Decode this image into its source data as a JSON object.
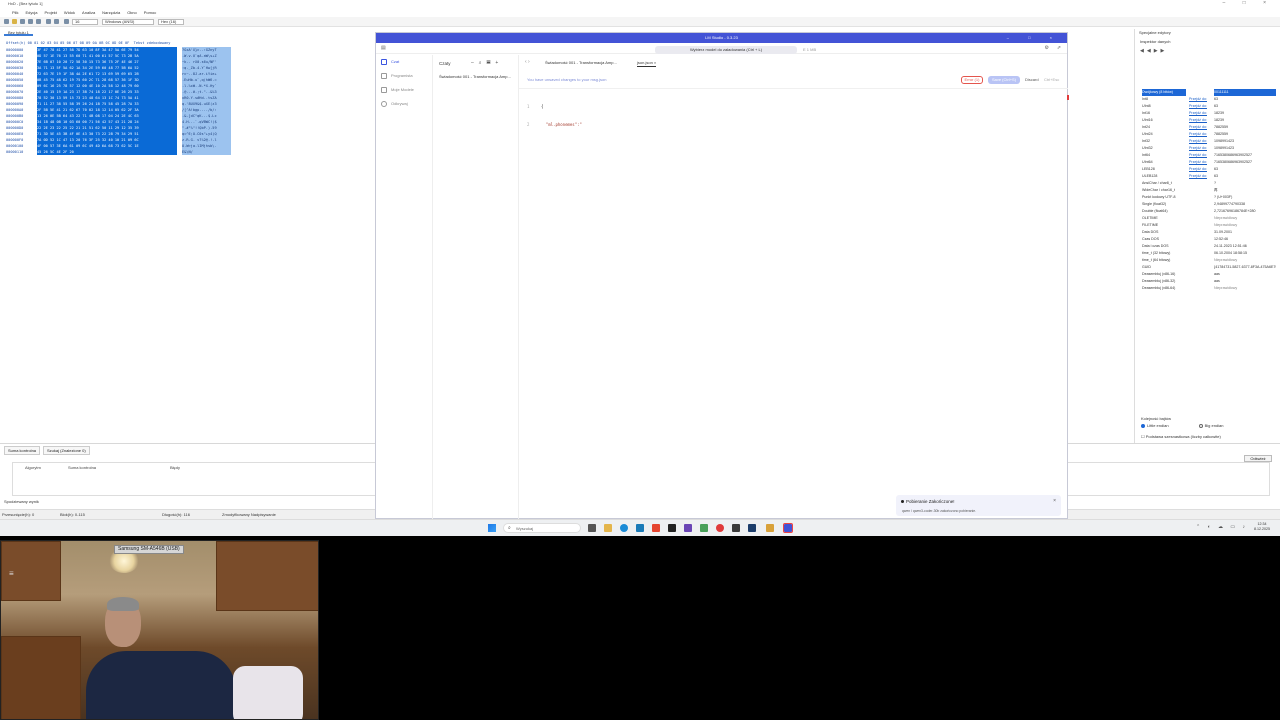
{
  "hxd": {
    "title": "HxD - [Bez tytułu 1]",
    "menu": [
      "Plik",
      "Edycja",
      "Projekt",
      "Widok",
      "Analiza",
      "Narzędzia",
      "Okno",
      "Pomoc"
    ],
    "bytes_per_row": "16",
    "encoding": "Windows (ANSI)",
    "number_base": "Hex (16)",
    "file_tab": "Bez tytułu 1",
    "hex_header": "Offset(h) 00 01 02 03 04 05 06 07 08 09 0A 0B 0C 0D 0E 0F  Tekst zdekodowany",
    "offsets": [
      "00000000",
      "00000010",
      "00000020",
      "00000030",
      "00000040",
      "00000050",
      "00000060",
      "00000070",
      "00000080",
      "00000090",
      "000000A0",
      "000000B0",
      "000000C0",
      "000000D0",
      "000000E0",
      "000000F0",
      "00000100",
      "00000110"
    ],
    "hex_rows": [
      "3F 47 78 41 27 58 7D 63 10 8F 3A 47 5A 6E 79 54",
      "0D 57 1E 76 13 55 60 71 41 00 61 57 5C 73 2B 5A",
      "7E 6B 07 10 20 72 58 30 15 73 36 75 2F 4E 46 27",
      "3A 71 13 5F 5A 62 1A 34 2E 59 60 48 77 5B 6A 52",
      "72 63 7E 19 1F 38 4A 2E 61 72 13 69 59 69 65 2B",
      "0B 45 75 48 62 19 75 60 2C 71 28 68 57 36 1F 3D",
      "09 6C 16 25 78 57 12 00 4E 10 2A 58 12 48 79 60",
      "2E 40 15 19 1A 23 17 3B 74 18 22 17 0E 26 25 33",
      "78 52 30 13 59 15 73 23 48 64 13 1C 74 73 5A 41",
      "71 11 27 38 55 58 39 26 24 1B 75 58 45 28 7A 33",
      "2F 5B 5E 41 21 62 67 70 02 18 12 14 05 62 2F 3A",
      "13 26 0E 5B 64 43 22 71 4B 08 17 04 24 2E 4C 63",
      "34 1B 48 0B 10 03 60 00 71 56 42 57 43 21 28 24",
      "22 2E 23 22 25 22 21 21 51 62 50 11 29 12 35 39",
      "71 3D 5E 45 3B 4F 0E 43 30 73 22 2B 79 34 29 51",
      "7A 0D 52 1C 47 13 20 76 3F 25 32 40 10 21 09 6C",
      "4F 00 57 3E 6A 61 09 6C 49 4D 6A 68 73 62 5C 1E",
      "45 26 5C 4E 2F 20"
    ],
    "text_rows": [
      "?GxA'X}c..:GZnyT",
      ".W.v.U`qA.aW\\s+Z",
      "~k.. rX0.s6u/NF'",
      ":q._Zb.4.Y`Hw[jR",
      "rc~..8J.ar.iYie+",
      ".EuHb.u`,q(hW6.=",
      ".l.%xW..N.*X.Hy`",
      ".@...#.;t.\"..&%3",
      "xR0.Y.s#Hd..tsZA",
      "q.'8UX9&$.uXE(z3",
      "/[^A!bgp..../b/:",
      ".&.[dC\"qK...$.Lc",
      "4.H...`.qVBWC!($",
      "\".#\"%\"!!QbP.).59",
      "q=^E;O.C0s\"+y4)Q",
      "z.R.G. v?%2@.!.l",
      "O.W>ja.lIMjhsb\\.",
      "E&\\N/ "
    ],
    "panel_tabs": [
      "Suma kontrolna",
      "Szukaj (Znalezione 0)"
    ],
    "panel_headers": [
      "Algorytm",
      "Suma kontrolna",
      "Błędy"
    ],
    "panel_button": "Odśwież",
    "panel_check": "Spodziewany wynik",
    "status": {
      "offset": "Przesunięcie(h): 0",
      "block": "Blok(h): 0-115",
      "length": "Długość(h): 116",
      "mode": "Zmodyfikowany  Nadpisywanie"
    }
  },
  "inspector": {
    "title": "Specjalne edytory",
    "subtitle": "Inspektor danych",
    "rows": [
      {
        "k": "Dwójkowy (8 bitów)",
        "l": "",
        "v": "00111111",
        "sel": true
      },
      {
        "k": "Int8",
        "l": "Przejdź do:",
        "v": "63"
      },
      {
        "k": "UInt8",
        "l": "Przejdź do:",
        "v": "63"
      },
      {
        "k": "Int16",
        "l": "Przejdź do:",
        "v": "18239"
      },
      {
        "k": "UInt16",
        "l": "Przejdź do:",
        "v": "18239"
      },
      {
        "k": "Int24",
        "l": "Przejdź do:",
        "v": "7882559"
      },
      {
        "k": "UInt24",
        "l": "Przejdź do:",
        "v": "7882559"
      },
      {
        "k": "Int32",
        "l": "Przejdź do:",
        "v": "1098991423"
      },
      {
        "k": "UInt32",
        "l": "Przejdź do:",
        "v": "1098991423"
      },
      {
        "k": "Int64",
        "l": "Przejdź do:",
        "v": "7165380686963902527"
      },
      {
        "k": "UInt64",
        "l": "Przejdź do:",
        "v": "7165380686963902527"
      },
      {
        "k": "LEB128",
        "l": "Przejdź do:",
        "v": "63"
      },
      {
        "k": "ULEB128",
        "l": "Przejdź do:",
        "v": "63"
      },
      {
        "k": "AnsiChar / char8_t",
        "l": "",
        "v": "?"
      },
      {
        "k": "WideChar / char16_t",
        "l": "",
        "v": "再"
      },
      {
        "k": "Punkt kodowy UTF-8",
        "l": "",
        "v": "? (U+003F)"
      },
      {
        "k": "Single (float32)",
        "l": "",
        "v": "2,94899774790338"
      },
      {
        "k": "Double (float64)",
        "l": "",
        "v": "2,72167696186784E+280"
      },
      {
        "k": "OLETIME",
        "l": "",
        "v": "Nieprawidłowy",
        "na": true
      },
      {
        "k": "FILETIME",
        "l": "",
        "v": "Nieprawidłowy",
        "na": true
      },
      {
        "k": "Data DOS",
        "l": "",
        "v": "31.09.2001"
      },
      {
        "k": "Czas DOS",
        "l": "",
        "v": "12:52:46"
      },
      {
        "k": "Data i czas DOS",
        "l": "",
        "v": "24.11.2023 12:51:46"
      },
      {
        "k": "time_t (32 bitowy)",
        "l": "",
        "v": "06.10.2004 18:58:15"
      },
      {
        "k": "time_t (64 bitowy)",
        "l": "",
        "v": "Nieprawidłowy",
        "na": true
      },
      {
        "k": "GUID",
        "l": "",
        "v": "{41784731-5827-6377-8F3A-475A6E7954}"
      },
      {
        "k": "Deasembluj (x86-16)",
        "l": "",
        "v": "aas"
      },
      {
        "k": "Deasembluj (x86-32)",
        "l": "",
        "v": "aas"
      },
      {
        "k": "Deasembluj (x86-64)",
        "l": "",
        "v": "Nieprawidłowy",
        "na": true
      }
    ],
    "byte_order_title": "Kolejność bajtów",
    "little_endian": "Little endian",
    "big_endian": "Big endian",
    "hex_check": "Podstawa szesnastkowa (liczby całkowite)"
  },
  "lm": {
    "title": "LM Studio - 0.3.23",
    "model_select": "Wybierz model do załadowania  (Ctrl + L)",
    "model_extra": "E 1 MB",
    "nav": [
      "Czat",
      "Programista",
      "Moje Modele",
      "Odkrywaj"
    ],
    "chats_title": "Czaty",
    "chat_item": "Świadomość 001 - Transformacja Amp...",
    "tab1": "Świadomość 001 - Transformacja Amp...",
    "tab2": "json.json",
    "unsaved": "You have unsaved changes to your msg.json",
    "errors": "Error (1)",
    "save": "Save (Ctrl+S)",
    "discard": "Discard",
    "discard_kbd": "Ctrl+Esc",
    "code": [
      "{",
      "  \"ml.phonemes\":\""
    ],
    "toast_title": "Pobieranie Zakończone!",
    "toast_body": "qwen / qwen3-coder-30b zakończono pobieranie."
  },
  "taskbar": {
    "search": "Wyszukaj",
    "time": "12:34",
    "date": "8.12.2025"
  },
  "webcam": {
    "label": "Samsung SM-A546B (USB)"
  },
  "colors": {
    "lm_accent": "#4353d6",
    "hex_selection": "#0a6ad6",
    "text_selection": "#9cc3ef"
  }
}
